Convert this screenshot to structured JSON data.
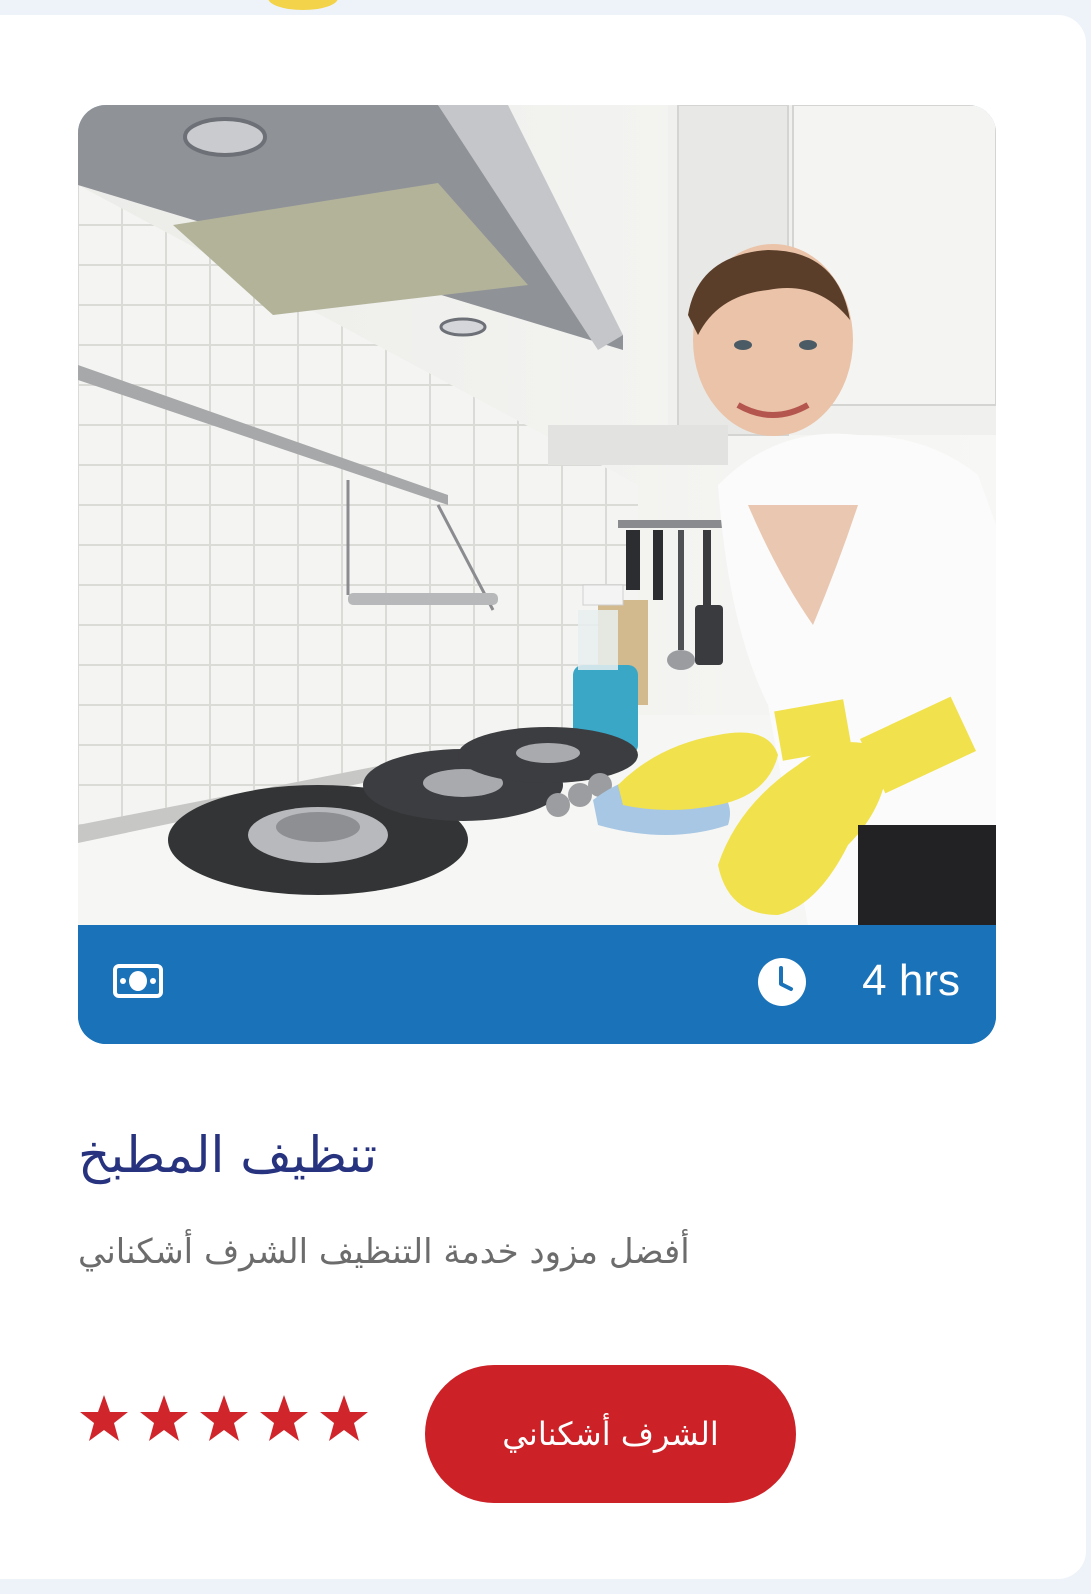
{
  "service": {
    "title": "تنظيف المطبخ",
    "subtitle": "أفضل مزود خدمة التنظيف الشرف أشكناني",
    "duration": "4 hrs",
    "rating": 5,
    "rating_max": 5,
    "book_label": "الشرف أشكناني",
    "photo_icon": "kitchen-cleaning-photo",
    "price_icon": "money-icon",
    "time_icon": "clock-icon"
  },
  "colors": {
    "accent_blue": "#1a73b9",
    "title_navy": "#27337f",
    "button_red": "#cc2126",
    "star_red": "#d0262b"
  }
}
